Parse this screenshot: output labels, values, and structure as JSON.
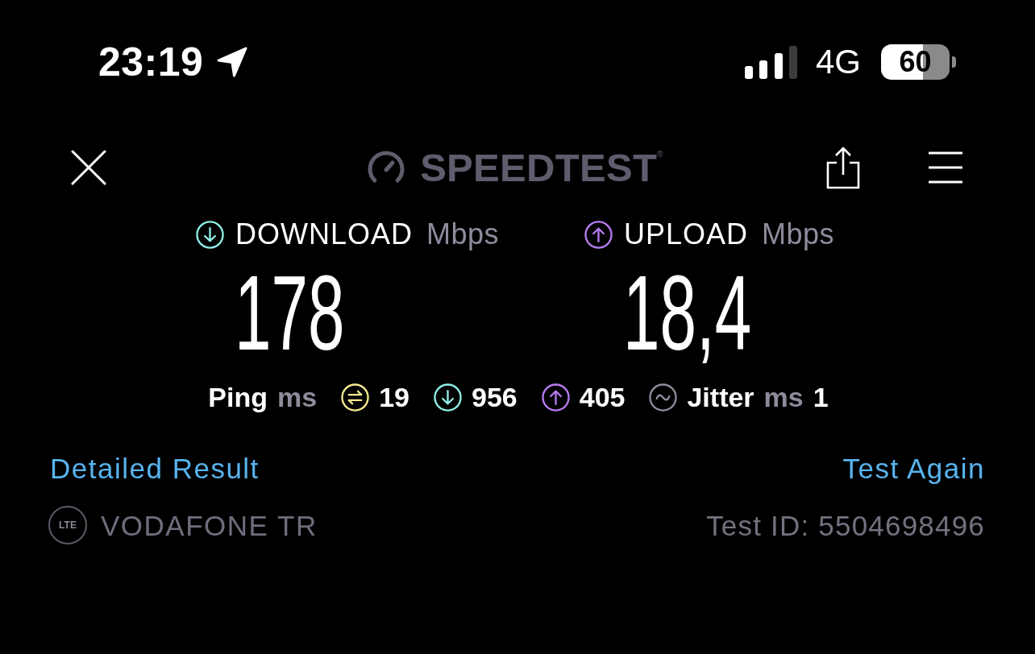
{
  "status_bar": {
    "time": "23:19",
    "network": "4G",
    "battery": "60"
  },
  "header": {
    "logo": "SPEEDTEST$^{®}$"
  },
  "results": [
    {
      "kind": "download",
      "label": "DOWNLOAD",
      "unit": "Mbps",
      "value": "178",
      "color": "#8eefe6"
    },
    {
      "kind": "upload",
      "label": "UPLOAD",
      "unit": "Mbps",
      "value": "18,4",
      "color": "#b57cf0"
    }
  ],
  "ping": {
    "label": "Ping",
    "unit": "ms",
    "readings": [
      {
        "kind": "idle",
        "value": "19",
        "color": "#f4ea8e"
      },
      {
        "kind": "download",
        "value": "956",
        "color": "#8eefe6"
      },
      {
        "kind": "upload",
        "value": "405",
        "color": "#b57cf0"
      }
    ]
  },
  "jitter": {
    "label": "Jitter",
    "unit": "ms",
    "value": "1"
  },
  "links": [
    "Detailed Result",
    "Test Again"
  ],
  "carrier": {
    "badge": "LTE",
    "name": "VODAFONE TR"
  },
  "test_id": "Test ID: 5504698496"
}
